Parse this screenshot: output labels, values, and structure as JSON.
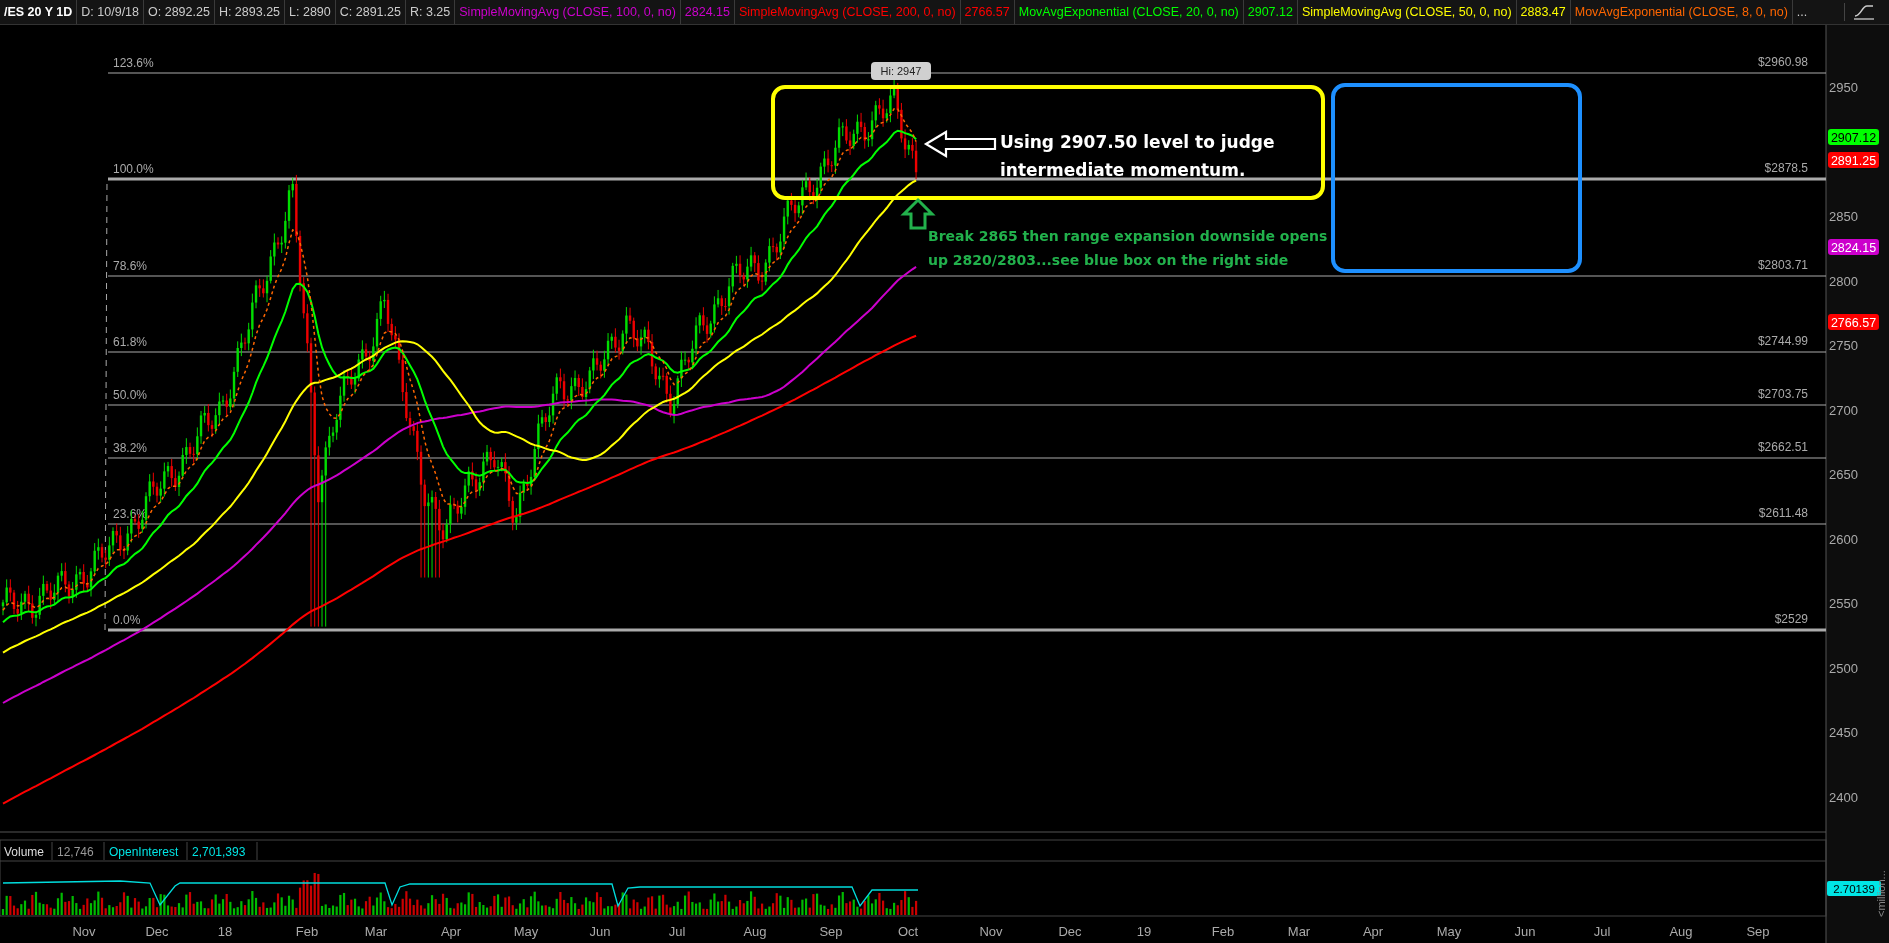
{
  "header": {
    "symbol": "/ES 20 Y 1D",
    "fields": [
      "D: 10/9/18",
      "O: 2892.25",
      "H: 2893.25",
      "L: 2890",
      "C: 2891.25",
      "R: 3.25"
    ],
    "studies": [
      {
        "label": "SimpleMovingAvg (CLOSE, 100, 0, no)",
        "value": "2824.15",
        "color": "#cc00cc"
      },
      {
        "label": "SimpleMovingAvg (CLOSE, 200, 0, no)",
        "value": "2766.57",
        "color": "#ff0000"
      },
      {
        "label": "MovAvgExponential (CLOSE, 20, 0, no)",
        "value": "2907.12",
        "color": "#00ff00"
      },
      {
        "label": "SimpleMovingAvg (CLOSE, 50, 0, no)",
        "value": "2883.47",
        "color": "#ffff00"
      },
      {
        "label": "MovAvgExponential (CLOSE, 8, 0, no)",
        "color": "#ff6600"
      }
    ],
    "more": "..."
  },
  "high_label": "Hi: 2947",
  "fib_levels": [
    {
      "percent": "123.6%",
      "price": "$2960.98"
    },
    {
      "percent": "100.0%",
      "price": "$2878.5"
    },
    {
      "percent": "78.6%",
      "price": "$2803.71"
    },
    {
      "percent": "61.8%",
      "price": "$2744.99"
    },
    {
      "percent": "50.0%",
      "price": "$2703.75"
    },
    {
      "percent": "38.2%",
      "price": "$2662.51"
    },
    {
      "percent": "23.6%",
      "price": "$2611.48"
    },
    {
      "percent": "0.0%",
      "price": "$2529"
    }
  ],
  "annotations": {
    "white_callout": "Using 2907.50 level to judge intermediate momentum.",
    "green_callout": "Break 2865 then range expansion downside opens up 2820/2803...see blue box on the right side"
  },
  "price_axis": {
    "ticks": [
      "2950",
      "2850",
      "2800",
      "2750",
      "2700",
      "2650",
      "2600",
      "2550",
      "2500",
      "2450",
      "2400"
    ],
    "markers": [
      {
        "value": "2907.12",
        "color": "#00ff00"
      },
      {
        "value": "2891.25",
        "color": "#ff0000"
      },
      {
        "value": "2824.15",
        "color": "#cc00cc"
      },
      {
        "value": "2766.57",
        "color": "#ff0000"
      }
    ]
  },
  "volume": {
    "label": "Volume",
    "value": "12,746",
    "oi_label": "OpenInterest",
    "oi_value": "2,701,393",
    "axis_marker": "2.70139",
    "axis_unit": "<million..."
  },
  "time_axis": [
    "Nov",
    "Dec",
    "18",
    "Feb",
    "Mar",
    "Apr",
    "May",
    "Jun",
    "Jul",
    "Aug",
    "Sep",
    "Oct",
    "Nov",
    "Dec",
    "19",
    "Feb",
    "Mar",
    "Apr",
    "May",
    "Jun",
    "Jul",
    "Aug",
    "Sep"
  ]
}
